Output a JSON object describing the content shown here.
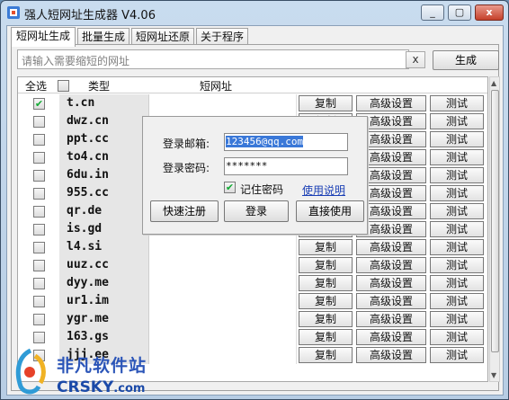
{
  "window": {
    "title": "强人短网址生成器 V4.06",
    "controls": [
      "_",
      "▢",
      "x"
    ]
  },
  "tabs": [
    {
      "label": "短网址生成",
      "active": true
    },
    {
      "label": "批量生成",
      "active": false
    },
    {
      "label": "短网址还原",
      "active": false
    },
    {
      "label": "关于程序",
      "active": false
    }
  ],
  "toolbar": {
    "url_placeholder": "请输入需要缩短的网址",
    "clear_label": "x",
    "generate_label": "生成"
  },
  "grid": {
    "headers": {
      "select_all": "全选",
      "type": "类型",
      "short_url": "短网址"
    },
    "button_labels": {
      "copy": "复制",
      "advanced": "高级设置",
      "test": "测试"
    },
    "rows": [
      {
        "domain": "t.cn",
        "checked": true
      },
      {
        "domain": "dwz.cn",
        "checked": false
      },
      {
        "domain": "ppt.cc",
        "checked": false
      },
      {
        "domain": "to4.cn",
        "checked": false
      },
      {
        "domain": "6du.in",
        "checked": false
      },
      {
        "domain": "955.cc",
        "checked": false
      },
      {
        "domain": "qr.de",
        "checked": false
      },
      {
        "domain": "is.gd",
        "checked": false
      },
      {
        "domain": "l4.si",
        "checked": false
      },
      {
        "domain": "uuz.cc",
        "checked": false
      },
      {
        "domain": "dyy.me",
        "checked": false
      },
      {
        "domain": "ur1.im",
        "checked": false
      },
      {
        "domain": "ygr.me",
        "checked": false
      },
      {
        "domain": "163.gs",
        "checked": false
      },
      {
        "domain": "jjj.ee",
        "checked": false
      }
    ]
  },
  "login_dialog": {
    "email_label": "登录邮箱:",
    "email_value": "123456@qq.com",
    "password_label": "登录密码:",
    "password_value": "*******",
    "remember_label": "记住密码",
    "remember_checked": true,
    "help_link": "使用说明",
    "quick_register": "快速注册",
    "login": "登录",
    "direct_use": "直接使用"
  },
  "watermark": {
    "cn": "非凡软件站",
    "en": "CRSKY",
    "en_suffix": ".com"
  },
  "colors": {
    "accent_blue": "#3a78d8",
    "link": "#1a3fb5",
    "close_red": "#c5402a"
  }
}
